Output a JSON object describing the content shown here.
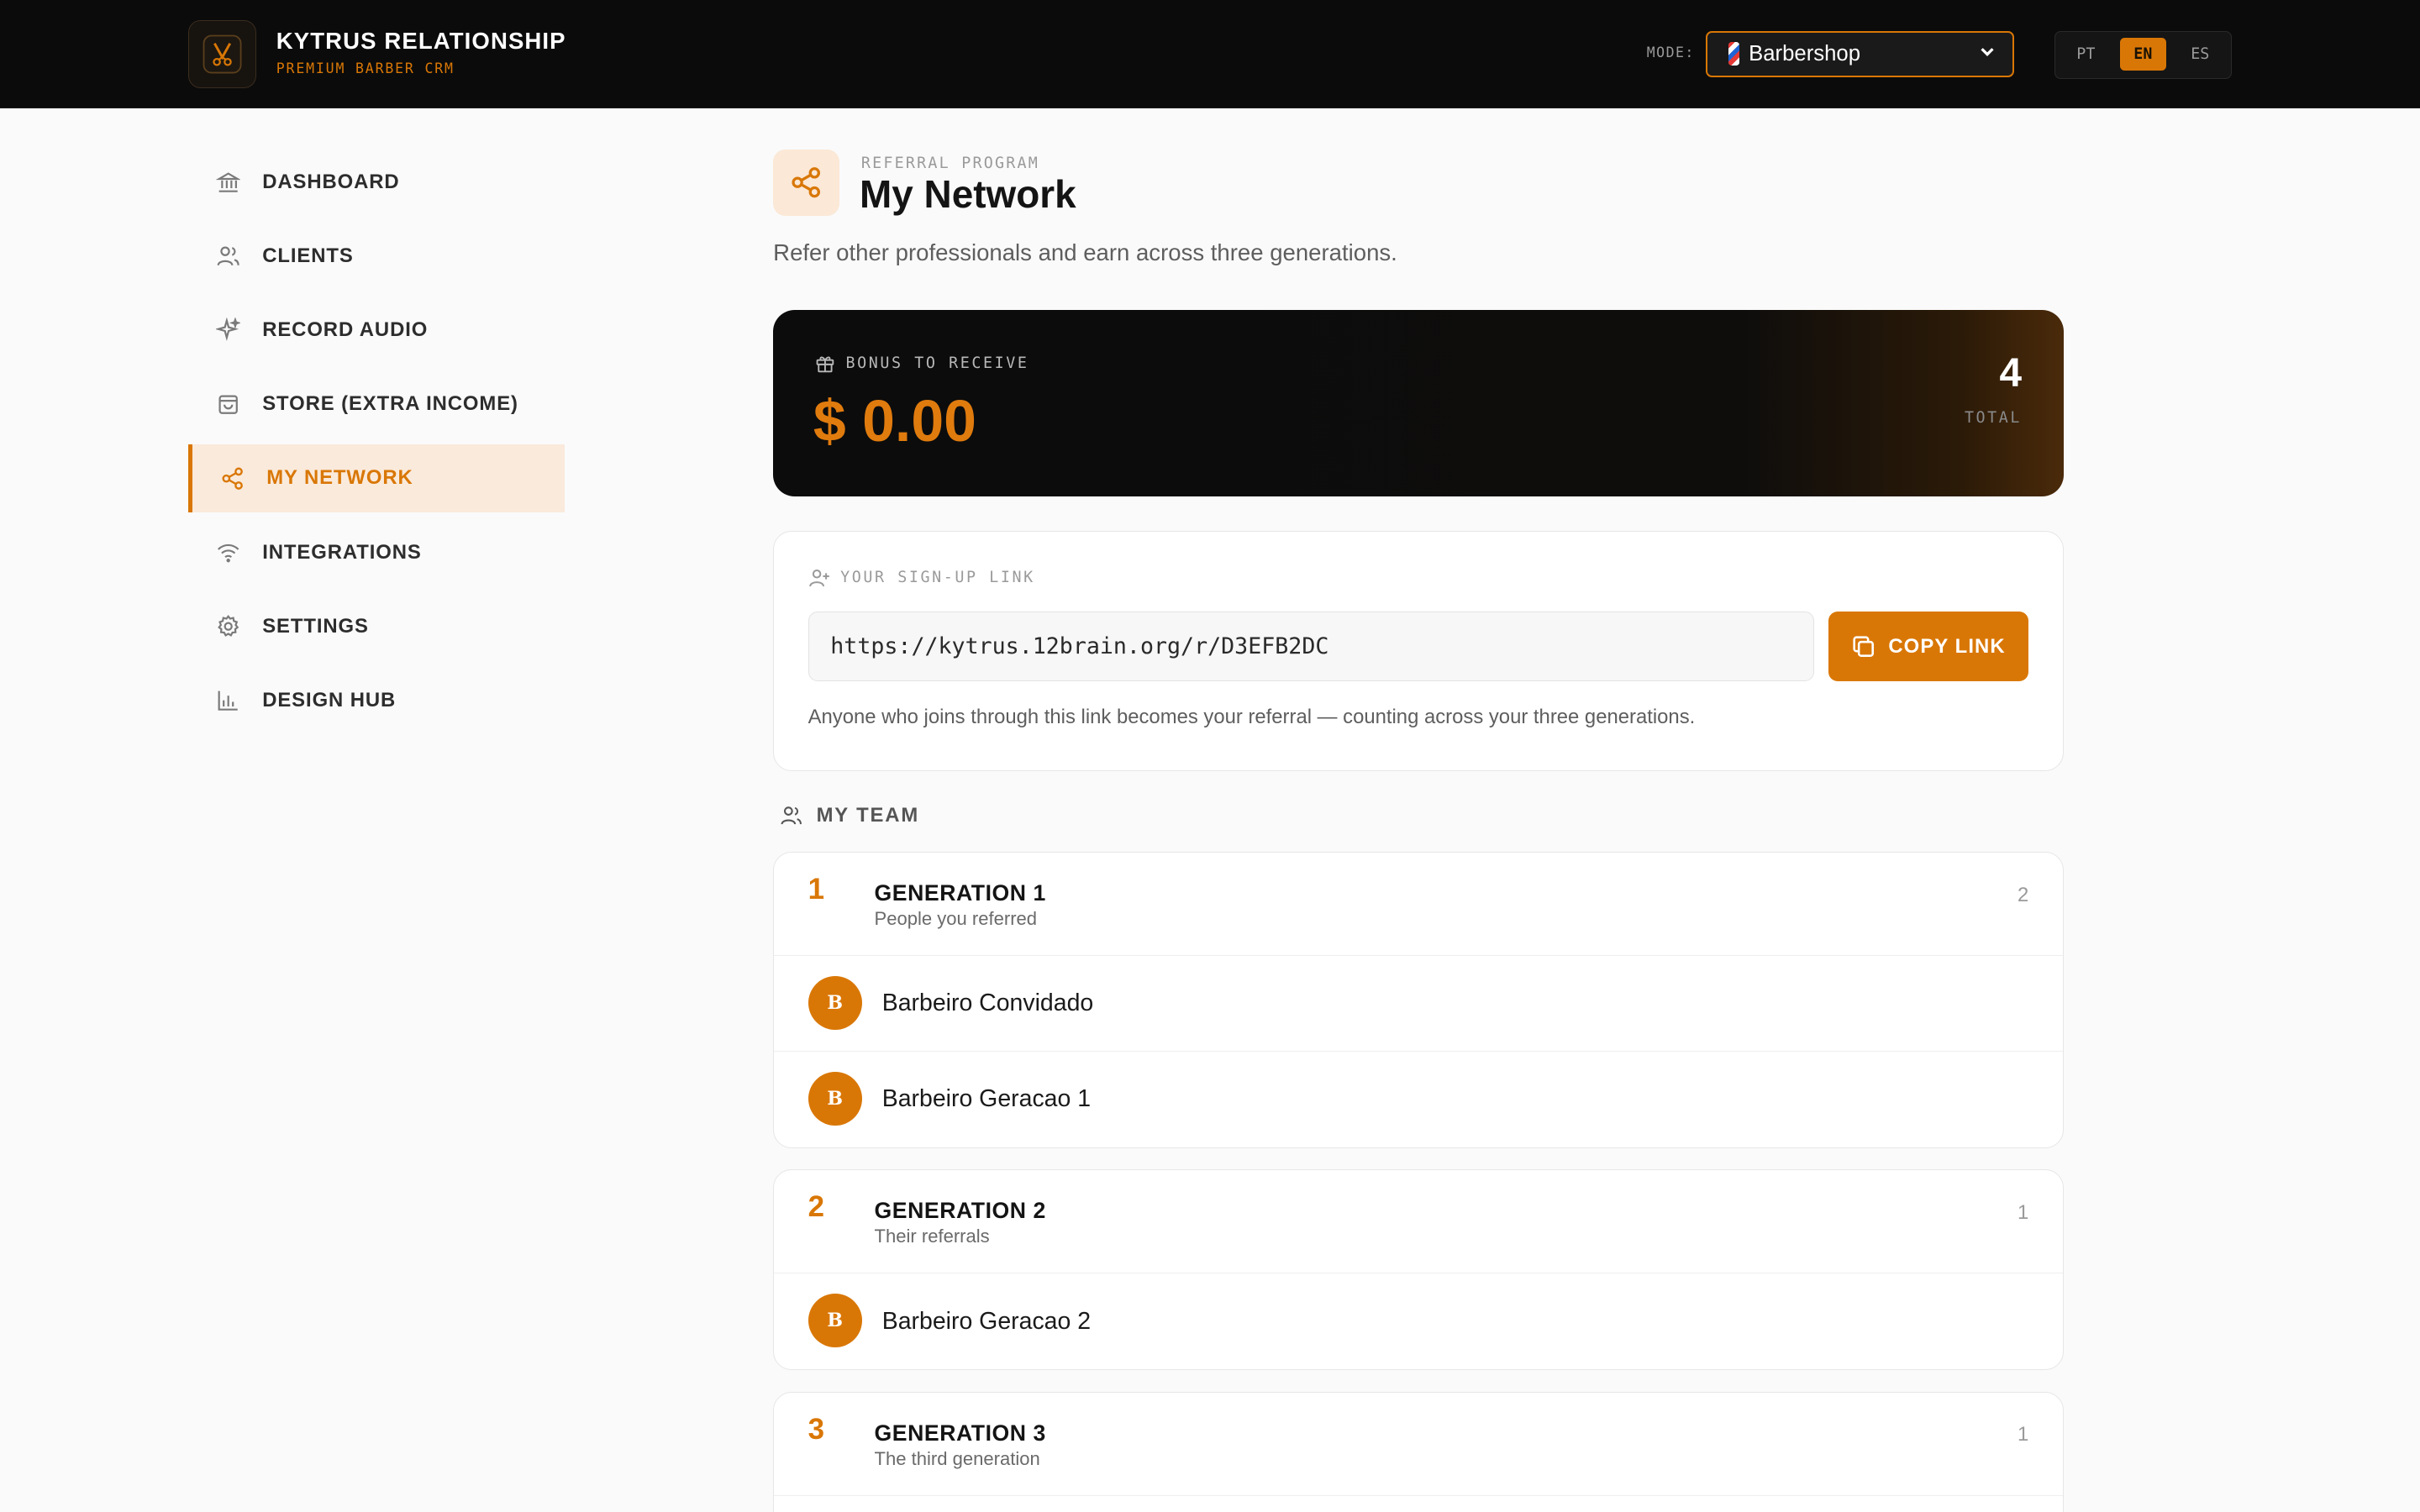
{
  "app": {
    "brand_title": "KYTRUS RELATIONSHIP",
    "brand_subtitle": "PREMIUM BARBER CRM",
    "mode_label": "MODE:",
    "mode_value": "Barbershop",
    "languages": [
      "PT",
      "EN",
      "ES"
    ],
    "active_language": "EN"
  },
  "sidebar": {
    "items": [
      {
        "label": "DASHBOARD",
        "icon": "bank-icon"
      },
      {
        "label": "CLIENTS",
        "icon": "users-icon"
      },
      {
        "label": "RECORD AUDIO",
        "icon": "sparkles-icon"
      },
      {
        "label": "STORE (EXTRA INCOME)",
        "icon": "shopping-bag-icon"
      },
      {
        "label": "MY NETWORK",
        "icon": "share-icon",
        "active": true
      },
      {
        "label": "INTEGRATIONS",
        "icon": "wifi-icon"
      },
      {
        "label": "SETTINGS",
        "icon": "gear-icon"
      },
      {
        "label": "DESIGN HUB",
        "icon": "bar-chart-icon"
      }
    ]
  },
  "page": {
    "eyebrow": "REFERRAL PROGRAM",
    "title": "My Network",
    "subtitle": "Refer other professionals and earn across three generations."
  },
  "bonus": {
    "label": "BONUS TO RECEIVE",
    "amount": "$ 0.00",
    "total_value": "4",
    "total_label": "TOTAL"
  },
  "signup": {
    "label": "YOUR SIGN-UP LINK",
    "url": "https://kytrus.12brain.org/r/D3EFB2DC",
    "copy_label": "COPY LINK",
    "note": "Anyone who joins through this link becomes your referral — counting across your three generations."
  },
  "team": {
    "heading": "MY TEAM",
    "generations": [
      {
        "number": "1",
        "title": "GENERATION 1",
        "description": "People you referred",
        "count": "2",
        "members": [
          {
            "initial": "B",
            "name": "Barbeiro Convidado"
          },
          {
            "initial": "B",
            "name": "Barbeiro Geracao 1"
          }
        ]
      },
      {
        "number": "2",
        "title": "GENERATION 2",
        "description": "Their referrals",
        "count": "1",
        "members": [
          {
            "initial": "B",
            "name": "Barbeiro Geracao 2"
          }
        ]
      },
      {
        "number": "3",
        "title": "GENERATION 3",
        "description": "The third generation",
        "count": "1",
        "members": []
      }
    ]
  },
  "colors": {
    "accent": "#d97706",
    "header_bg": "#0b0b0b",
    "page_bg": "#fafafa",
    "active_nav_bg": "#faeadb"
  }
}
